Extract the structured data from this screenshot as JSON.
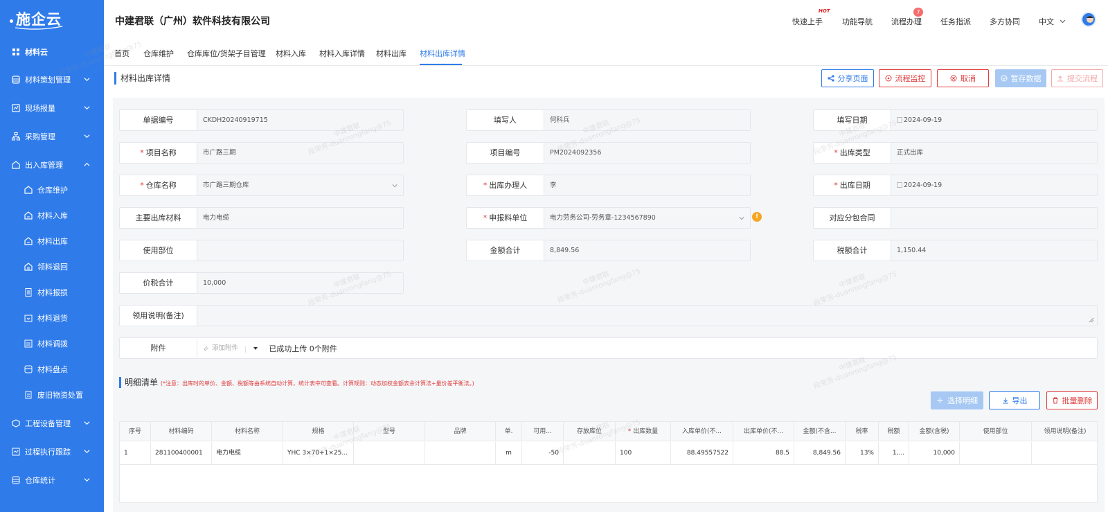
{
  "app": {
    "logo_text": "施企云",
    "company": "中建君联（广州）软件科技有限公司"
  },
  "topbar": {
    "quick_start": "快速上手",
    "hot_label": "HOT",
    "function_nav": "功能导航",
    "process": "流程办理",
    "process_badge": "7",
    "task_assign": "任务指派",
    "collab": "多方协同",
    "language": "中文"
  },
  "sidebar": {
    "top": "材料云",
    "material_plan": "材料策划管理",
    "site_report": "现场报量",
    "purchase": "采购管理",
    "inout": "出入库管理",
    "sub": {
      "warehouse": "仓库维护",
      "inbound": "材料入库",
      "outbound": "材料出库",
      "return_pick": "领料退回",
      "loss": "材料报损",
      "return_goods": "材料退货",
      "transfer": "材料调拨",
      "inventory": "材料盘点",
      "scrap": "废旧物资处置"
    },
    "equipment": "工程设备管理",
    "tracking": "过程执行跟踪",
    "stats": "仓库统计"
  },
  "tabs": [
    "首页",
    "仓库维护",
    "仓库库位/货架子目管理",
    "材料入库",
    "材料入库详情",
    "材料出库",
    "材料出库详情"
  ],
  "page": {
    "heading": "材料出库详情"
  },
  "actions": {
    "share": "分享页面",
    "monitor": "流程监控",
    "cancel": "取消",
    "save": "暂存数据",
    "submit": "提交流程"
  },
  "form": {
    "doc_no": {
      "label": "单据编号",
      "value": "CKDH20240919715"
    },
    "filler": {
      "label": "填写人",
      "value": "何科兵"
    },
    "fill_date": {
      "label": "填写日期",
      "value": "2024-09-19"
    },
    "project_name": {
      "label": "项目名称",
      "value": "市广路三期"
    },
    "project_no": {
      "label": "项目编号",
      "value": "PM2024092356"
    },
    "out_type": {
      "label": "出库类型",
      "value": "正式出库"
    },
    "warehouse": {
      "label": "仓库名称",
      "value": "市广路三期仓库"
    },
    "handler": {
      "label": "出库办理人",
      "value": "李"
    },
    "out_date": {
      "label": "出库日期",
      "value": "2024-09-19"
    },
    "main_material": {
      "label": "主要出库材料",
      "value": "电力电缆"
    },
    "apply_unit": {
      "label": "申报料单位",
      "value": "电力劳务公司-劳务章-1234567890"
    },
    "sub_contract": {
      "label": "对应分包合同",
      "value": ""
    },
    "dept": {
      "label": "使用部位",
      "value": ""
    },
    "amount_total": {
      "label": "金额合计",
      "value": "8,849.56"
    },
    "tax_total": {
      "label": "税额合计",
      "value": "1,150.44"
    },
    "price_tax_total": {
      "label": "价税合计",
      "value": "10,000"
    },
    "remark": {
      "label": "领用说明(备注)",
      "value": ""
    },
    "attachment": {
      "label": "附件",
      "add": "添加附件",
      "status": "已成功上传 0个附件"
    }
  },
  "detail": {
    "title": "明细清单",
    "note": "(*注意：出库时的单价、金额、税额等由系统自动计算，统计表中可查看。计算规则：动态加权金额去余计算法+量价差平衡法。)",
    "select_btn": "选择明细",
    "export_btn": "导出",
    "delete_btn": "批量删除",
    "columns": [
      "序号",
      "材料编码",
      "材料名称",
      "规格",
      "型号",
      "品牌",
      "单.",
      "可用...",
      "存放库位",
      "出库数量",
      "入库单价(不...",
      "出库单价(不...",
      "金额(不含...",
      "税率",
      "税额",
      "金额(含税)",
      "使用部位",
      "领用说明(备注)"
    ],
    "rows": [
      {
        "seq": "1",
        "code": "281100400001",
        "name": "电力电缆",
        "spec": "YHC 3×70+1×25...",
        "model": "",
        "brand": "",
        "unit": "m",
        "avail": "-50",
        "location": "",
        "qty": "100",
        "in_price": "88.49557522",
        "out_price": "88.5",
        "amount": "8,849.56",
        "tax_rate": "13%",
        "tax": "1,...",
        "amount_tax": "10,000",
        "dept": "",
        "remark": ""
      }
    ]
  },
  "watermark": {
    "line1": "中建君联",
    "line2": "段荣芳-duanrongfang@75"
  }
}
